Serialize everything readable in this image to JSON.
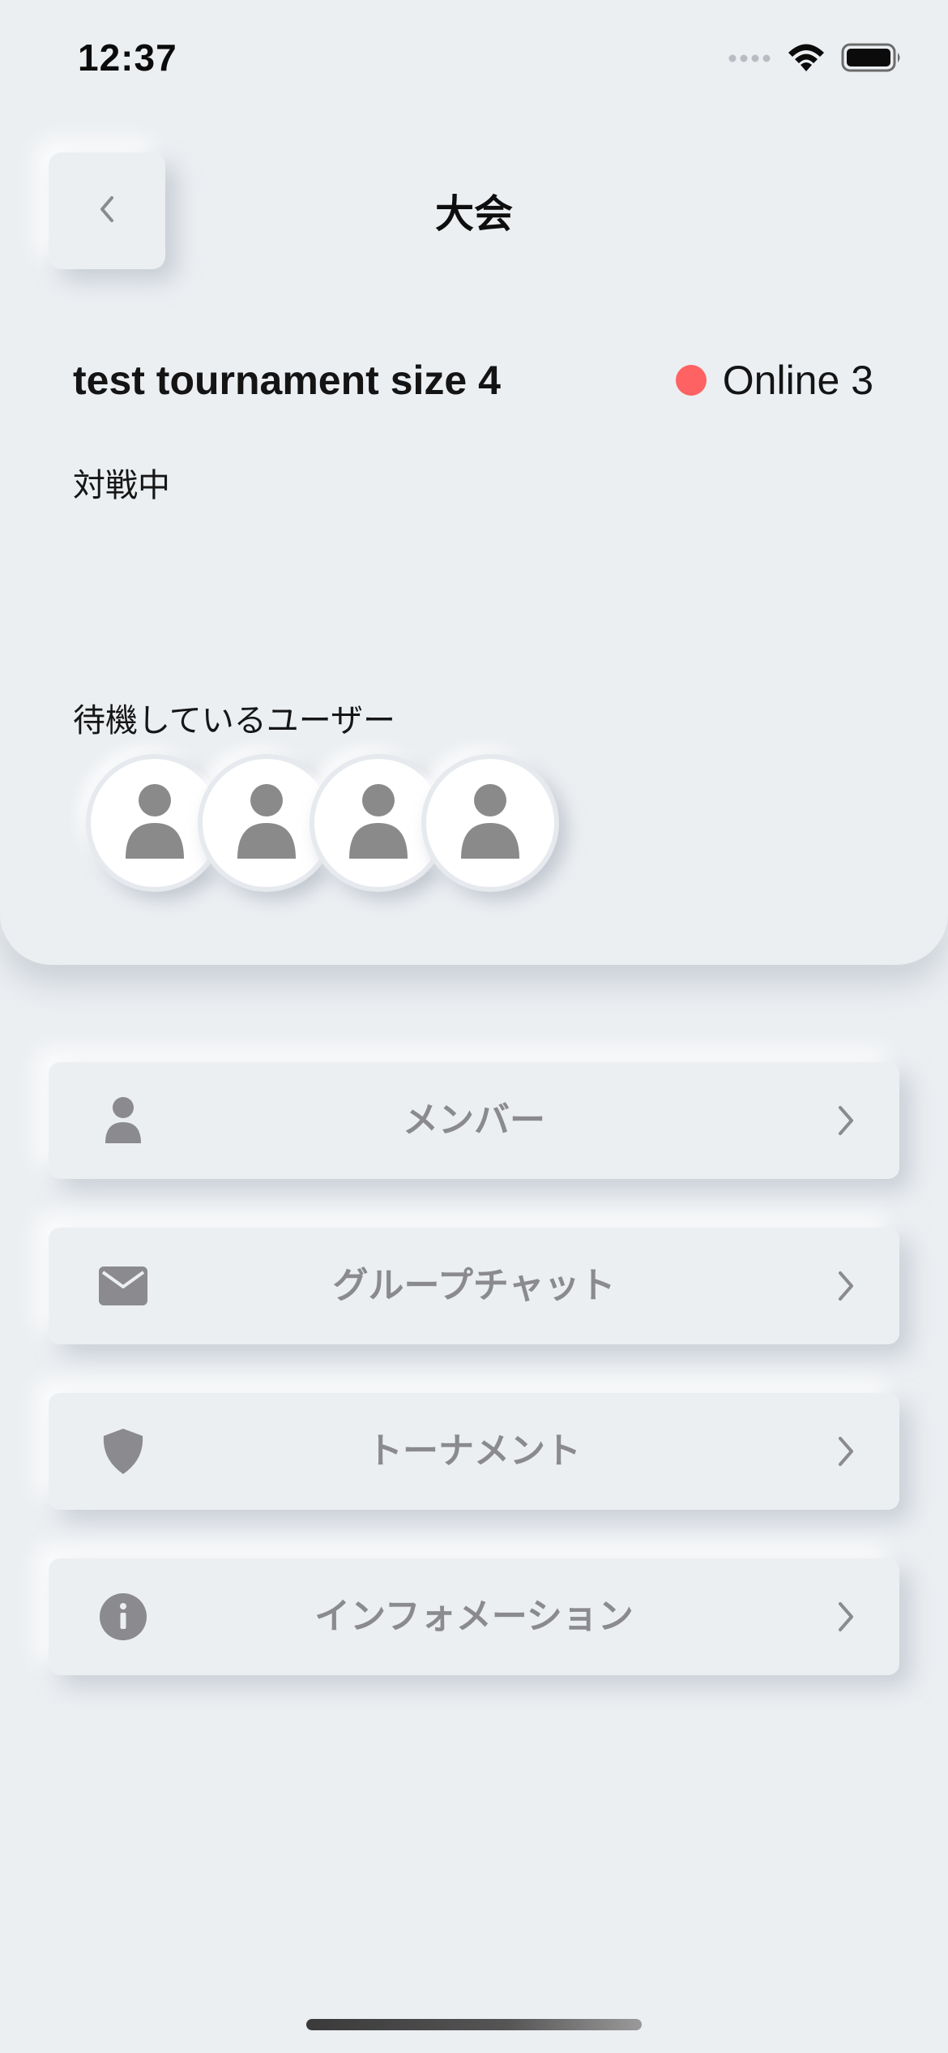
{
  "status_bar": {
    "time": "12:37",
    "icons": [
      "cellular-signal-icon",
      "wifi-icon",
      "battery-icon"
    ]
  },
  "header": {
    "title": "大会",
    "back_icon": "chevron-left-icon"
  },
  "tournament": {
    "name": "test tournament size 4",
    "online_label": "Online 3",
    "online_dot_color": "#ff6262",
    "status": "対戦中",
    "waiting_users_label": "待機しているユーザー",
    "waiting_users": [
      {
        "avatar": "user-avatar-icon"
      },
      {
        "avatar": "user-avatar-icon"
      },
      {
        "avatar": "user-avatar-icon"
      },
      {
        "avatar": "user-avatar-icon"
      }
    ]
  },
  "menu": {
    "items": [
      {
        "label": "メンバー",
        "icon": "person-icon"
      },
      {
        "label": "グループチャット",
        "icon": "envelope-icon"
      },
      {
        "label": "トーナメント",
        "icon": "shield-icon"
      },
      {
        "label": "インフォメーション",
        "icon": "info-icon"
      }
    ]
  },
  "colors": {
    "background": "#eceff2",
    "menu_text": "#8a8a8f",
    "icon_gray": "#8a8a8f",
    "online_dot": "#ff6262"
  }
}
